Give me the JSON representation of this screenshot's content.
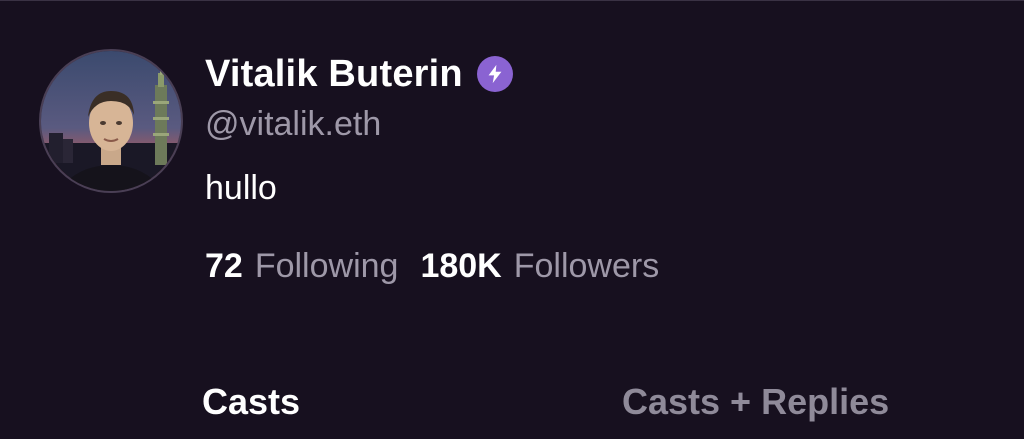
{
  "profile": {
    "display_name": "Vitalik Buterin",
    "handle": "@vitalik.eth",
    "bio": "hullo",
    "verified_icon": "lightning-bolt-icon",
    "badge_color": "#8a63d2"
  },
  "stats": {
    "following_count": "72",
    "following_label": "Following",
    "followers_count": "180K",
    "followers_label": "Followers"
  },
  "tabs": {
    "casts": "Casts",
    "casts_replies": "Casts + Replies",
    "active": "Casts"
  },
  "colors": {
    "background": "#17101f",
    "primary_text": "#ffffff",
    "secondary_text": "#9e98a8"
  }
}
